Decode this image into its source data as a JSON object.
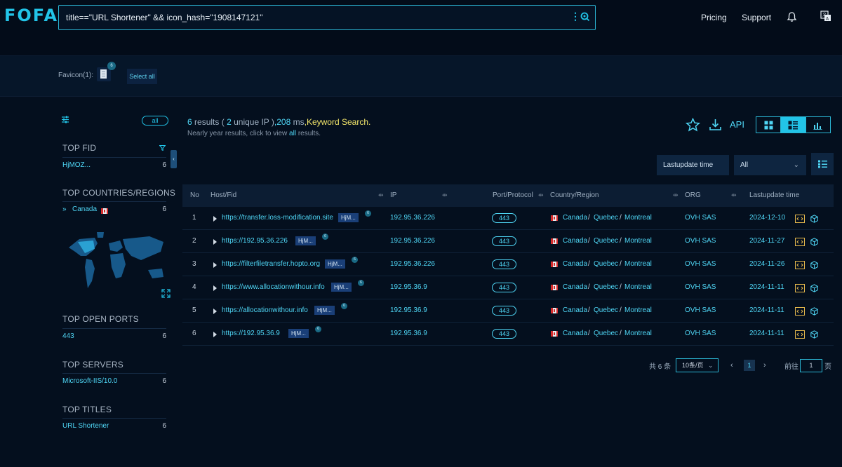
{
  "header": {
    "logo": "FOFA",
    "query": "title==\"URL Shortener\" && icon_hash=\"1908147121\"",
    "nav": [
      "Pricing",
      "Support"
    ],
    "icons": [
      "more-vertical-icon",
      "search-icon",
      "bell-icon",
      "translate-icon"
    ]
  },
  "favicon_bar": {
    "label": "Favicon(1):",
    "badge": "6",
    "select_all": "Select all"
  },
  "sidebar": {
    "all": "all",
    "top_fid": {
      "title": "TOP FID",
      "items": [
        {
          "name": "HjMOZ...",
          "count": "6"
        }
      ]
    },
    "top_countries": {
      "title": "TOP COUNTRIES/REGIONS",
      "items": [
        {
          "name": "Canada",
          "count": "6"
        }
      ]
    },
    "top_ports": {
      "title": "TOP OPEN PORTS",
      "items": [
        {
          "name": "443",
          "count": "6"
        }
      ]
    },
    "top_servers": {
      "title": "TOP SERVERS",
      "items": [
        {
          "name": "Microsoft-IIS/10.0",
          "count": "6"
        }
      ]
    },
    "top_titles": {
      "title": "TOP TITLES",
      "items": [
        {
          "name": "URL Shortener",
          "count": "6"
        }
      ]
    }
  },
  "summary": {
    "results": "6",
    "results_label": "results (",
    "unique": "2",
    "unique_label": "unique IP )",
    "ms": ",208",
    "ms_label": "ms",
    "keyword": ",Keyword Search.",
    "sub_pre": "Nearly year results, click to view",
    "sub_link": "all",
    "sub_post": "results."
  },
  "toolbar": {
    "api": "API",
    "sort": "Lastupdate time",
    "filter": "All"
  },
  "table": {
    "headers": [
      "No",
      "Host/Fid",
      "IP",
      "Port/Protocol",
      "Country/Region",
      "ORG",
      "Lastupdate time"
    ],
    "rows": [
      {
        "no": "1",
        "host": "https://transfer.loss-modification.site",
        "fid": "HjM...",
        "fid_count": "6",
        "ip": "192.95.36.226",
        "port": "443",
        "country": "Canada",
        "region": "Quebec",
        "city": "Montreal",
        "org": "OVH SAS",
        "date": "2024-12-10"
      },
      {
        "no": "2",
        "host": "https://192.95.36.226",
        "fid": "HjM...",
        "fid_count": "6",
        "ip": "192.95.36.226",
        "port": "443",
        "country": "Canada",
        "region": "Quebec",
        "city": "Montreal",
        "org": "OVH SAS",
        "date": "2024-11-27"
      },
      {
        "no": "3",
        "host": "https://filterfiletransfer.hopto.org",
        "fid": "HjM...",
        "fid_count": "6",
        "ip": "192.95.36.226",
        "port": "443",
        "country": "Canada",
        "region": "Quebec",
        "city": "Montreal",
        "org": "OVH SAS",
        "date": "2024-11-26"
      },
      {
        "no": "4",
        "host": "https://www.allocationwithour.info",
        "fid": "HjM...",
        "fid_count": "6",
        "ip": "192.95.36.9",
        "port": "443",
        "country": "Canada",
        "region": "Quebec",
        "city": "Montreal",
        "org": "OVH SAS",
        "date": "2024-11-11"
      },
      {
        "no": "5",
        "host": "https://allocationwithour.info",
        "fid": "HjM...",
        "fid_count": "6",
        "ip": "192.95.36.9",
        "port": "443",
        "country": "Canada",
        "region": "Quebec",
        "city": "Montreal",
        "org": "OVH SAS",
        "date": "2024-11-11"
      },
      {
        "no": "6",
        "host": "https://192.95.36.9",
        "fid": "HjM...",
        "fid_count": "6",
        "ip": "192.95.36.9",
        "port": "443",
        "country": "Canada",
        "region": "Quebec",
        "city": "Montreal",
        "org": "OVH SAS",
        "date": "2024-11-11"
      }
    ]
  },
  "pagination": {
    "total": "共 6 条",
    "page_size": "10条/页",
    "current": "1",
    "goto": "前往",
    "goto_value": "1",
    "page_unit": "页"
  },
  "colors": {
    "accent": "#22c4e8",
    "highlight": "#f3e66a",
    "background": "#040f1e"
  }
}
